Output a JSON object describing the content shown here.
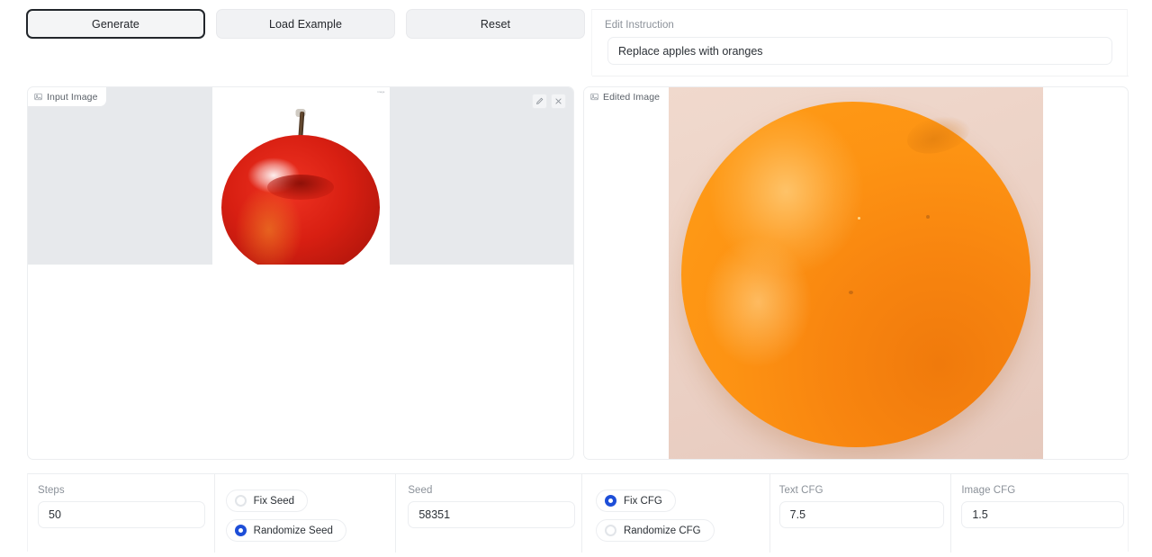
{
  "toolbar": {
    "generate_label": "Generate",
    "load_example_label": "Load Example",
    "reset_label": "Reset"
  },
  "instruction": {
    "label": "Edit Instruction",
    "value": "Replace apples with oranges",
    "placeholder": ""
  },
  "input_panel": {
    "badge_label": "Input Image",
    "badge_icon": "image-icon",
    "edit_icon": "pencil-icon",
    "clear_icon": "close-icon",
    "letterbox_color": "#e7e9ec",
    "image_alt": "red apple on white background"
  },
  "output_panel": {
    "badge_label": "Edited Image",
    "badge_icon": "image-icon",
    "background_color": "#ecd2c6",
    "image_alt": "orange on pink beige background"
  },
  "controls": {
    "steps": {
      "label": "Steps",
      "value": "50"
    },
    "seed_mode": {
      "options": [
        {
          "label": "Fix Seed",
          "selected": false
        },
        {
          "label": "Randomize Seed",
          "selected": true
        }
      ]
    },
    "seed": {
      "label": "Seed",
      "value": "58351"
    },
    "cfg_mode": {
      "options": [
        {
          "label": "Fix CFG",
          "selected": true
        },
        {
          "label": "Randomize CFG",
          "selected": false
        }
      ]
    },
    "text_cfg": {
      "label": "Text CFG",
      "value": "7.5"
    },
    "image_cfg": {
      "label": "Image CFG",
      "value": "1.5"
    }
  },
  "colors": {
    "accent_blue": "#1d4ed8",
    "button_bg": "#f1f2f4",
    "border": "#eceef1",
    "label_text": "#8b9199"
  }
}
